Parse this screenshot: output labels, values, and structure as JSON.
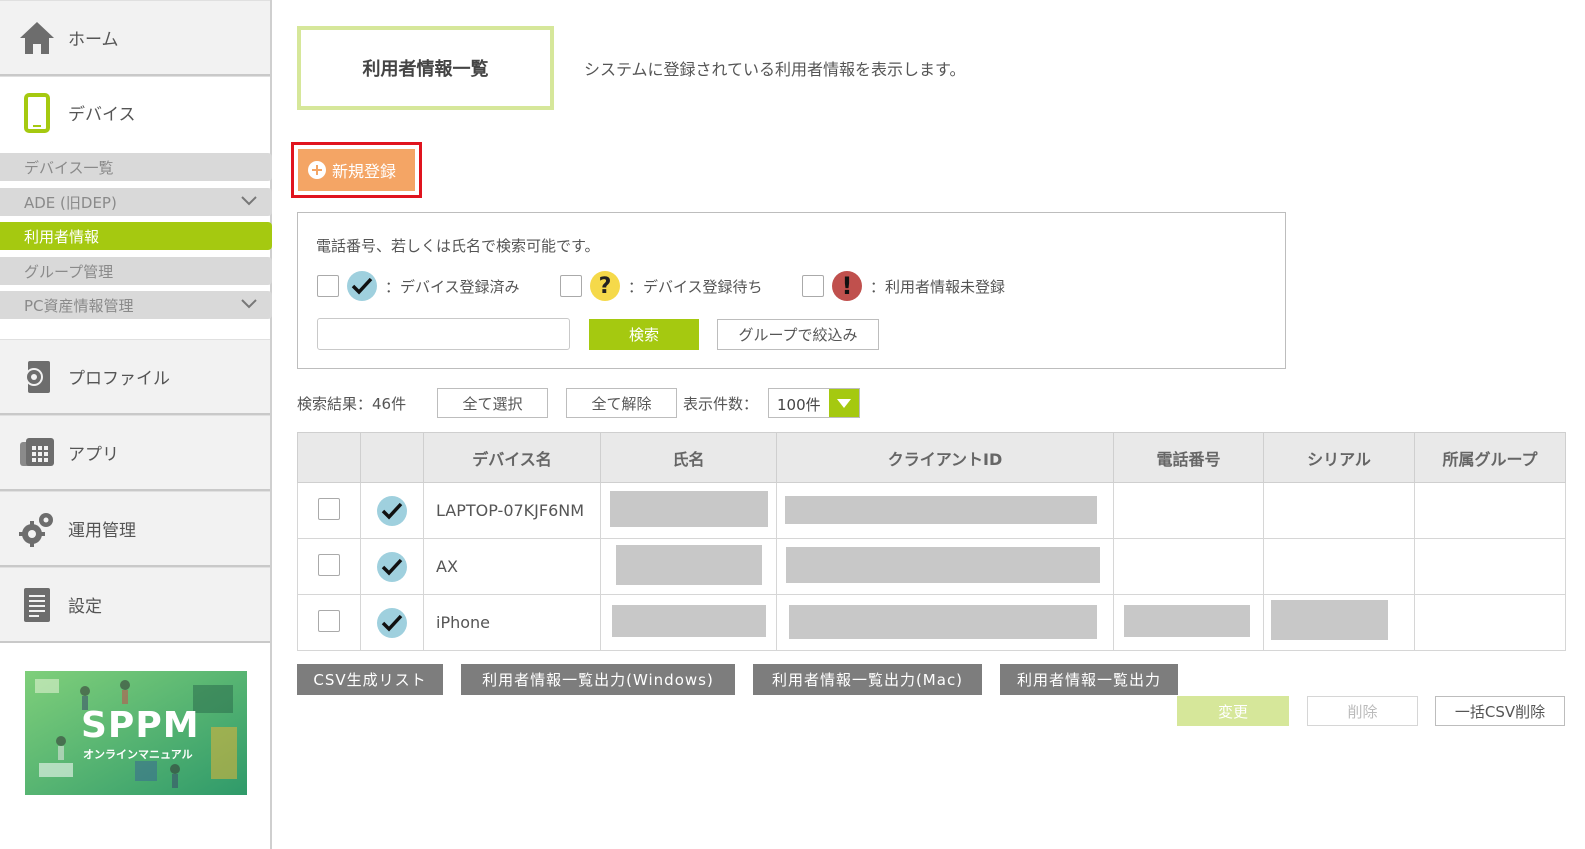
{
  "sidebar": {
    "home_label": "ホーム",
    "device_label": "デバイス",
    "sub_items": [
      {
        "label": "デバイス一覧"
      },
      {
        "label": "ADE (旧DEP)"
      },
      {
        "label": "利用者情報"
      },
      {
        "label": "グループ管理"
      },
      {
        "label": "PC資産情報管理"
      }
    ],
    "profile_label": "プロファイル",
    "apps_label": "アプリ",
    "operations_label": "運用管理",
    "settings_label": "設定",
    "banner": {
      "title": "SPPM",
      "subtitle": "オンラインマニュアル"
    }
  },
  "header": {
    "title": "利用者情報一覧",
    "description": "システムに登録されている利用者情報を表示します。"
  },
  "new_button_label": "新規登録",
  "search": {
    "hint": "電話番号、若しくは氏名で検索可能です。",
    "legend_registered": "：デバイス登録済み",
    "legend_waiting": "：デバイス登録待ち",
    "legend_unregistered": "：利用者情報未登録",
    "input_value": "",
    "search_button": "検索",
    "group_filter_button": "グループで絞込み"
  },
  "results": {
    "count_text": "検索結果：46件",
    "select_all": "全て選択",
    "deselect_all": "全て解除",
    "per_page_label": "表示件数：",
    "per_page_value": "100件"
  },
  "table": {
    "headers": [
      "",
      "",
      "デバイス名",
      "氏名",
      "クライアントID",
      "電話番号",
      "シリアル",
      "所属グループ"
    ],
    "rows": [
      {
        "device_name": "LAPTOP-07KJF6NM",
        "status": "registered"
      },
      {
        "device_name": "AX",
        "status": "registered"
      },
      {
        "device_name": "iPhone",
        "status": "registered"
      }
    ]
  },
  "export_buttons": {
    "csv_list": "CSV生成リスト",
    "export_windows": "利用者情報一覧出力(Windows)",
    "export_mac": "利用者情報一覧出力(Mac)",
    "export_all": "利用者情報一覧出力"
  },
  "actions": {
    "change": "変更",
    "delete": "削除",
    "bulk_csv_delete": "一括CSV削除"
  },
  "colors": {
    "accent_green": "#a5c910",
    "new_button_orange": "#f4a565",
    "highlight_red": "#e0141e",
    "status_registered": "#9fd0de",
    "status_waiting": "#f5d94a",
    "status_unregistered": "#c0504d"
  }
}
